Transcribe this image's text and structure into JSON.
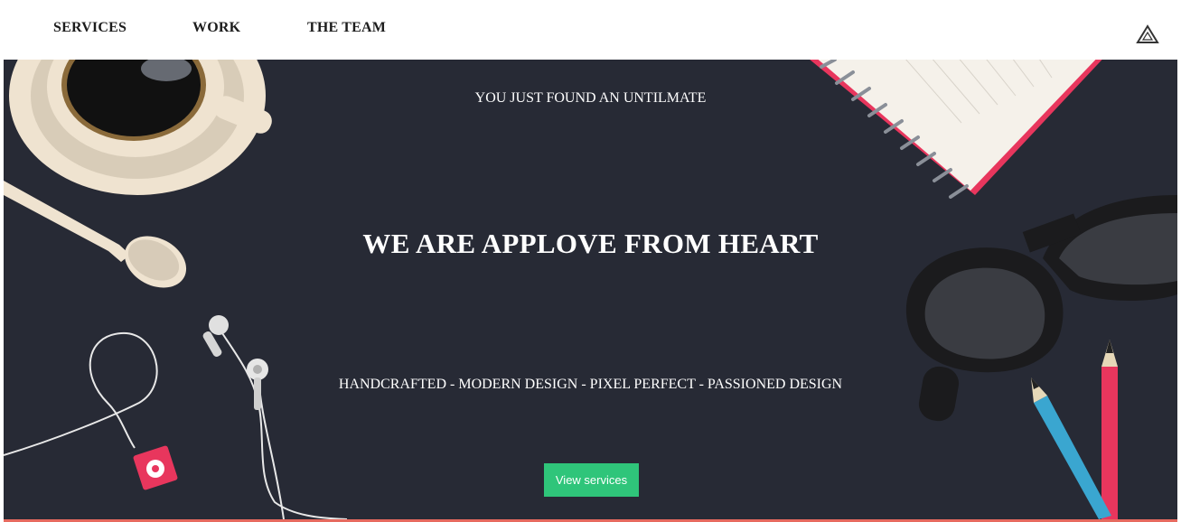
{
  "nav": {
    "items": [
      {
        "label": "SERVICES"
      },
      {
        "label": "WORK"
      },
      {
        "label": "THE TEAM"
      }
    ],
    "logo_icon": "triangle-logo-icon"
  },
  "hero": {
    "tagline": "YOU JUST FOUND AN UNTILMATE",
    "headline": "WE ARE APPLOVE FROM HEART",
    "features": "HANDCRAFTED - MODERN DESIGN - PIXEL PERFECT - PASSIONED DESIGN",
    "cta_label": "View services",
    "background_color": "#272a35",
    "cta_color": "#2fc57a",
    "accent_line_color": "#e66a5f",
    "decor_icons": [
      "coffee-cup-icon",
      "spoon-icon",
      "earphones-icon",
      "music-player-icon",
      "notebook-icon",
      "glasses-icon",
      "pencil-icon"
    ]
  }
}
